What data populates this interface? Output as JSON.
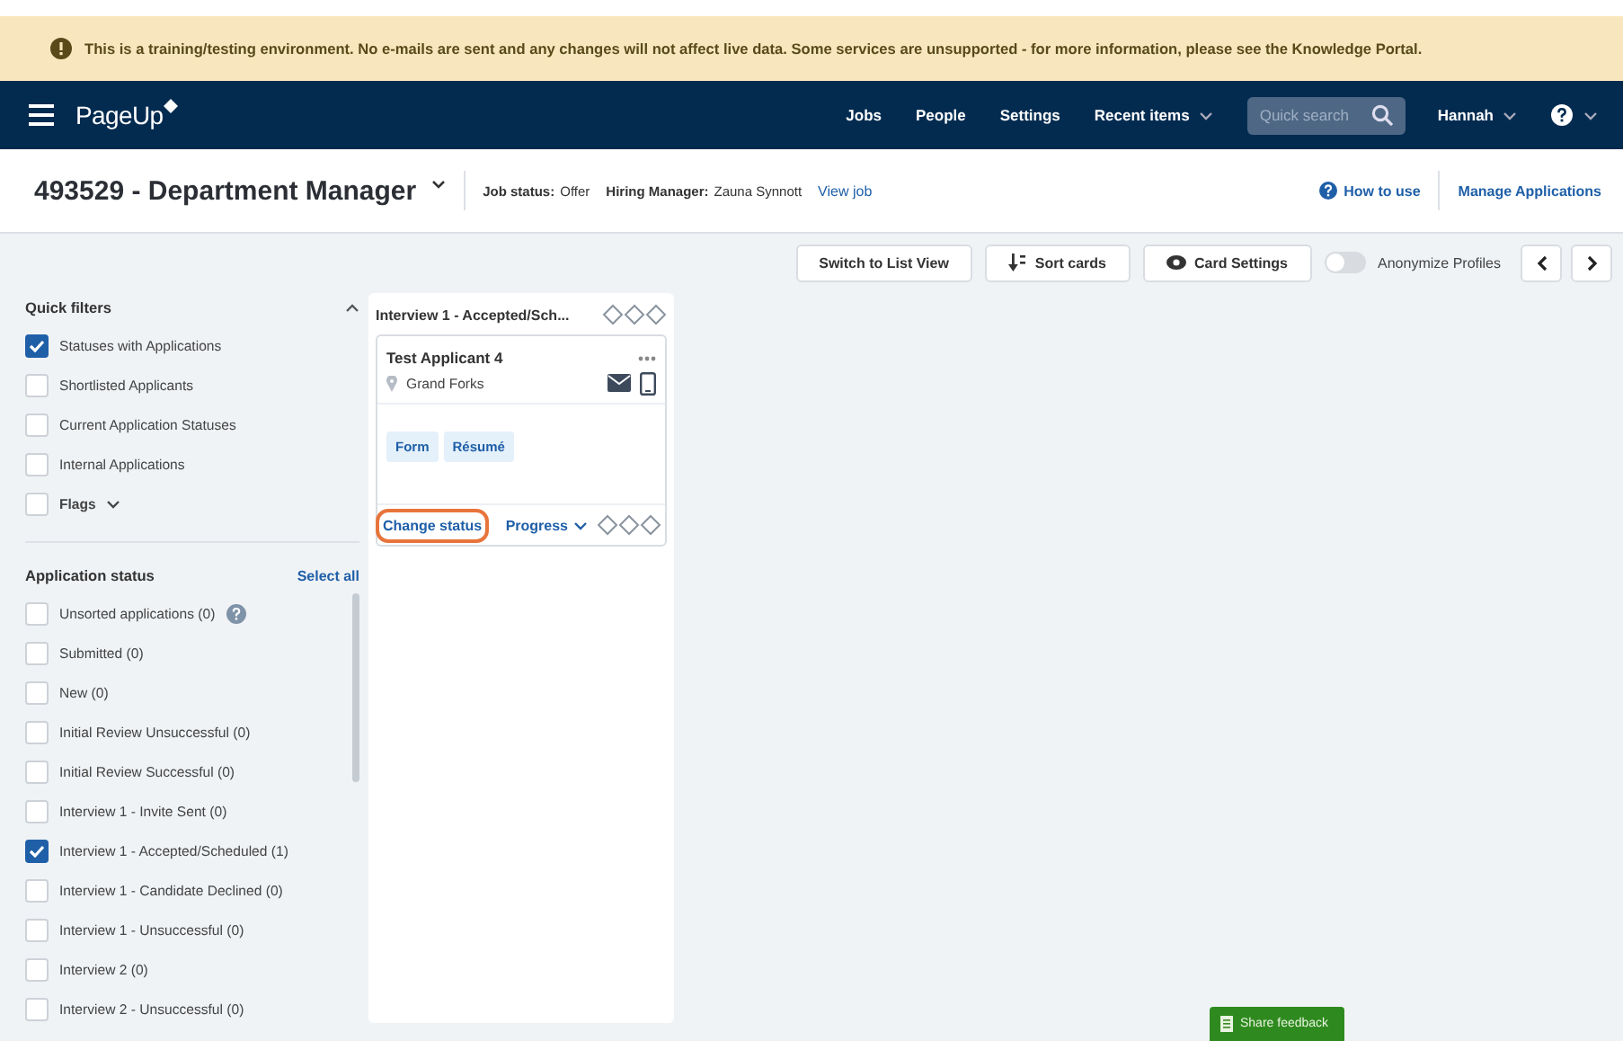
{
  "banner": {
    "text": "This is a training/testing environment. No e-mails are sent and any changes will not affect live data. Some services are unsupported - for more information, please see the Knowledge Portal."
  },
  "navbar": {
    "logo": "PageUp",
    "links": [
      {
        "label": "Jobs",
        "dropdown": false
      },
      {
        "label": "People",
        "dropdown": false
      },
      {
        "label": "Settings",
        "dropdown": false
      },
      {
        "label": "Recent items",
        "dropdown": true
      }
    ],
    "search": {
      "placeholder": "Quick search"
    },
    "user": "Hannah"
  },
  "job_header": {
    "title": "493529 - Department Manager",
    "status_label": "Job status:",
    "status": "Offer",
    "manager_label": "Hiring Manager:",
    "manager": "Zauna Synnott",
    "view_job": "View job",
    "how_to_use": "How to use",
    "manage": "Manage Applications"
  },
  "toolbar": {
    "buttons": [
      {
        "label": "Switch to List View",
        "kind": "plain"
      },
      {
        "label": "Sort cards",
        "kind": "sort"
      },
      {
        "label": "Card Settings",
        "kind": "eye"
      }
    ],
    "toggle": {
      "label": "Anonymize Profiles",
      "on": false
    }
  },
  "quick_filters": {
    "title": "Quick filters",
    "items": [
      {
        "label": "Statuses with Applications",
        "checked": true,
        "kind": "plain"
      },
      {
        "label": "Shortlisted Applicants",
        "checked": false,
        "kind": "plain"
      },
      {
        "label": "Current Application Statuses",
        "checked": false,
        "kind": "plain"
      },
      {
        "label": "Internal Applications",
        "checked": false,
        "kind": "plain"
      },
      {
        "label": "Flags",
        "checked": false,
        "kind": "dropdown"
      }
    ]
  },
  "application_status": {
    "title": "Application status",
    "select_all": "Select all",
    "items": [
      {
        "label": "Unsorted applications (0)",
        "checked": false,
        "help": true
      },
      {
        "label": "Submitted (0)",
        "checked": false,
        "help": false
      },
      {
        "label": "New (0)",
        "checked": false,
        "help": false
      },
      {
        "label": "Initial Review Unsuccessful (0)",
        "checked": false,
        "help": false
      },
      {
        "label": "Initial Review Successful (0)",
        "checked": false,
        "help": false
      },
      {
        "label": "Interview 1 - Invite Sent (0)",
        "checked": false,
        "help": false
      },
      {
        "label": "Interview 1 - Accepted/Scheduled (1)",
        "checked": true,
        "help": false
      },
      {
        "label": "Interview 1 - Candidate Declined (0)",
        "checked": false,
        "help": false
      },
      {
        "label": "Interview 1 - Unsuccessful (0)",
        "checked": false,
        "help": false
      },
      {
        "label": "Interview 2 (0)",
        "checked": false,
        "help": false
      },
      {
        "label": "Interview 2 - Unsuccessful (0)",
        "checked": false,
        "help": false
      }
    ]
  },
  "columns": [
    {
      "title": "Interview 1 - Accepted/Sch...",
      "cards": [
        {
          "name": "Test Applicant 4",
          "location": "Grand Forks",
          "documents": [
            "Form",
            "Résumé"
          ],
          "change_status": {
            "label": "Change status",
            "highlighted": true
          },
          "progress": "Progress"
        }
      ]
    }
  ],
  "feedback_button": "Share feedback"
}
